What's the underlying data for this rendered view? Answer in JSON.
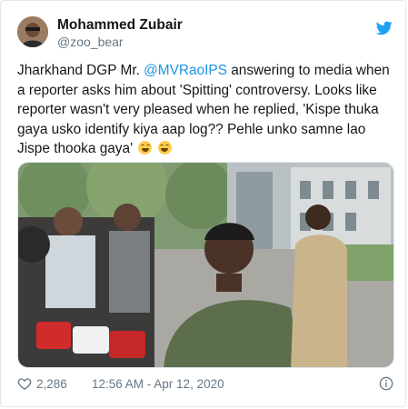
{
  "tweet": {
    "author_name": "Mohammed Zubair",
    "author_handle": "@zoo_bear",
    "text_before_mention": "Jharkhand DGP Mr. ",
    "mention": "@MVRaoIPS",
    "text_after_mention": " answering to media when a reporter asks him about 'Spitting' controversy. Looks like reporter wasn't very pleased when he replied, 'Kispe thuka gaya usko identify kiya aap log?? Pehle unko samne lao  Jispe thooka gaya' ",
    "like_count": "2,286",
    "timestamp": "12:56 AM - Apr 12, 2020"
  },
  "icons": {
    "brand": "twitter-bird-icon",
    "like": "heart-icon",
    "info": "info-icon",
    "emoji": "grinning-squinting-face-emoji"
  },
  "colors": {
    "brand_blue": "#1da1f2",
    "mention_blue": "#1b95e0",
    "secondary_text": "#657786",
    "border": "#e1e8ed"
  }
}
